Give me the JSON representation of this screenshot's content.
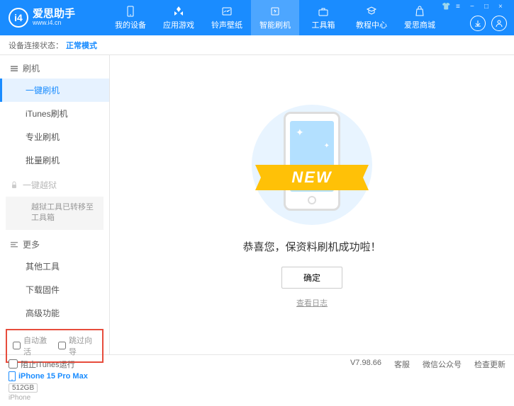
{
  "app": {
    "title": "爱思助手",
    "subtitle": "www.i4.cn",
    "logo_letter": "i4"
  },
  "nav": {
    "items": [
      {
        "label": "我的设备"
      },
      {
        "label": "应用游戏"
      },
      {
        "label": "铃声壁纸"
      },
      {
        "label": "智能刷机"
      },
      {
        "label": "工具箱"
      },
      {
        "label": "教程中心"
      },
      {
        "label": "爱思商城"
      }
    ]
  },
  "status": {
    "label": "设备连接状态：",
    "value": "正常模式"
  },
  "sidebar": {
    "section_flash": "刷机",
    "items_flash": [
      "一键刷机",
      "iTunes刷机",
      "专业刷机",
      "批量刷机"
    ],
    "section_jailbreak": "一键越狱",
    "jailbreak_note": "越狱工具已转移至工具箱",
    "section_more": "更多",
    "items_more": [
      "其他工具",
      "下载固件",
      "高级功能"
    ],
    "check_auto_activate": "自动激活",
    "check_skip_guide": "跳过向导"
  },
  "device": {
    "name": "iPhone 15 Pro Max",
    "storage": "512GB",
    "type": "iPhone"
  },
  "main": {
    "ribbon": "NEW",
    "success_text": "恭喜您，保资料刷机成功啦！",
    "ok_button": "确定",
    "log_link": "查看日志"
  },
  "footer": {
    "block_itunes": "阻止iTunes运行",
    "version": "V7.98.66",
    "links": [
      "客服",
      "微信公众号",
      "检查更新"
    ]
  }
}
